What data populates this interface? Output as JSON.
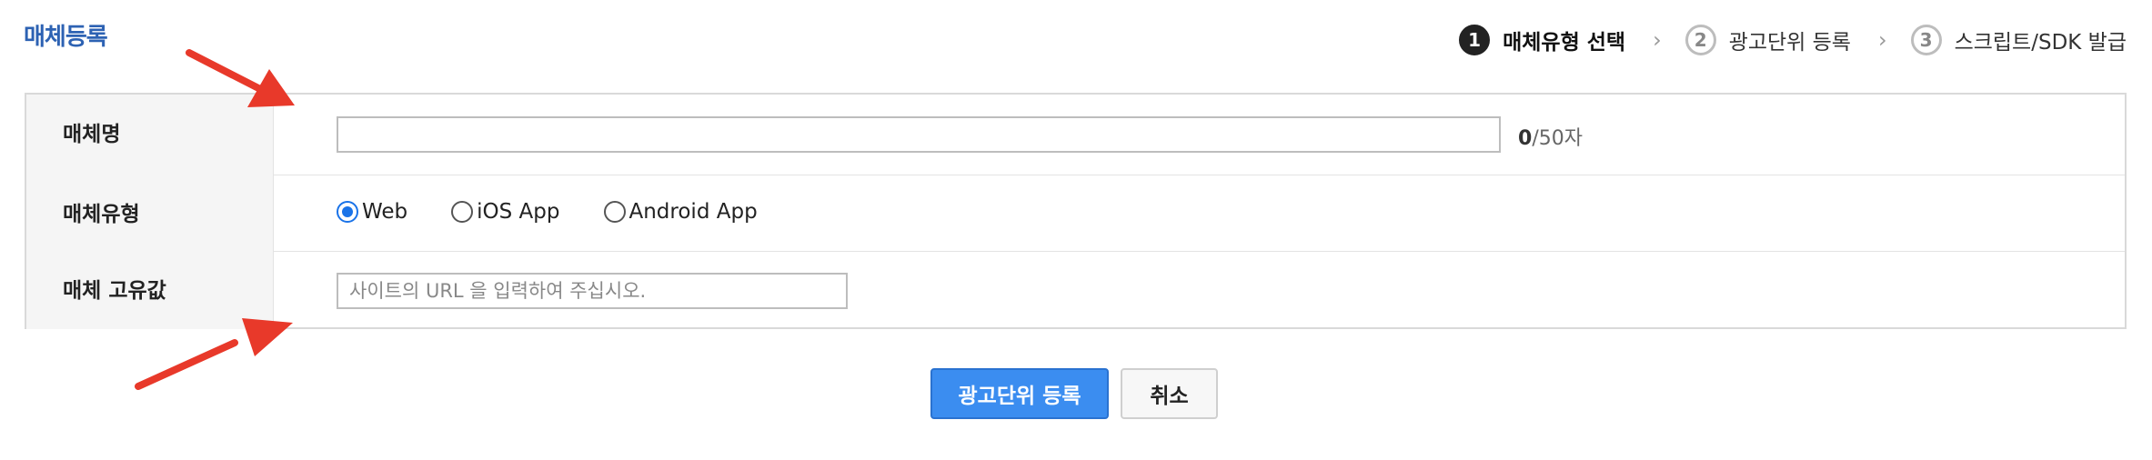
{
  "page": {
    "title": "매체등록"
  },
  "steps": [
    {
      "number": "1",
      "label": "매체유형 선택",
      "active": true
    },
    {
      "number": "2",
      "label": "광고단위 등록",
      "active": false
    },
    {
      "number": "3",
      "label": "스크립트/SDK 발급",
      "active": false
    }
  ],
  "form": {
    "name_row": {
      "label": "매체명",
      "value": "",
      "count": "0",
      "count_suffix": "/50자"
    },
    "type_row": {
      "label": "매체유형",
      "options": [
        {
          "label": "Web",
          "checked": true
        },
        {
          "label": "iOS App",
          "checked": false
        },
        {
          "label": "Android App",
          "checked": false
        }
      ]
    },
    "id_row": {
      "label": "매체 고유값",
      "value": "",
      "placeholder": "사이트의 URL 을 입력하여 주십시오."
    }
  },
  "buttons": {
    "submit_label": "광고단위 등록",
    "cancel_label": "취소"
  },
  "colors": {
    "title": "#2d62b3",
    "primary_button": "#3b8df0",
    "radio_checked": "#1a73e8",
    "annotation_arrow": "#e8392a"
  },
  "annotations": [
    {
      "name": "arrow-to-name-input"
    },
    {
      "name": "arrow-to-id-input"
    }
  ]
}
